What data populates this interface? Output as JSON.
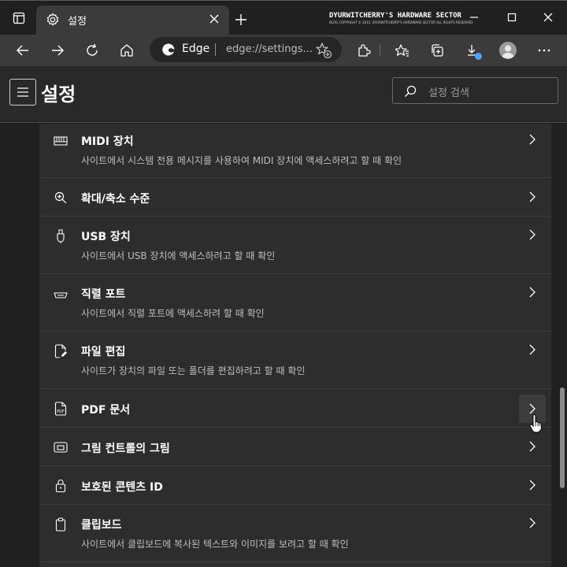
{
  "tab": {
    "title": "설정",
    "close": "✕"
  },
  "newtab": "+",
  "watermark": {
    "line1": "DYURWITCHERRY'S HARDWARE SECTOR",
    "line2": "BLOG COPYRIGHT © 2015. DYURWITCHERRY'S HARDWARE SECTOR ALL RIGHTS RESERVED."
  },
  "window_controls": {
    "minimize": "—",
    "maximize": "☐",
    "close": "✕"
  },
  "toolbar": {
    "browser_label": "Edge",
    "url": "edge://settings..."
  },
  "header": {
    "title": "설정",
    "search_placeholder": "설정 검색"
  },
  "rows": [
    {
      "icon": "keyboard-icon",
      "title": "MIDI 장치",
      "desc": "사이트에서 시스템 전용 메시지를 사용하여 MIDI 장치에 액세스하려고 할 때 확인"
    },
    {
      "icon": "zoom-icon",
      "title": "확대/축소 수준",
      "desc": ""
    },
    {
      "icon": "usb-icon",
      "title": "USB 장치",
      "desc": "사이트에서 USB 장치에 액세스하려고 할 때 확인"
    },
    {
      "icon": "serial-port-icon",
      "title": "직렬 포트",
      "desc": "사이트에서 직렬 포트에 액세스하려 할 때 확인"
    },
    {
      "icon": "file-edit-icon",
      "title": "파일 편집",
      "desc": "사이트가 장치의 파일 또는 폴더를 편집하려고 할 때 확인"
    },
    {
      "icon": "pdf-icon",
      "title": "PDF 문서",
      "desc": ""
    },
    {
      "icon": "picture-in-picture-icon",
      "title": "그림 컨트롤의 그림",
      "desc": ""
    },
    {
      "icon": "lock-icon",
      "title": "보호된 콘텐츠 ID",
      "desc": ""
    },
    {
      "icon": "clipboard-icon",
      "title": "클립보드",
      "desc": "사이트에서 클립보드에 복사된 텍스트와 이미지를 보려고 할 때 확인"
    }
  ],
  "colors": {
    "background": "#202020",
    "card": "#2d2d2d",
    "toolbar": "#3b3b3b",
    "accent": "#4aa3ff"
  }
}
